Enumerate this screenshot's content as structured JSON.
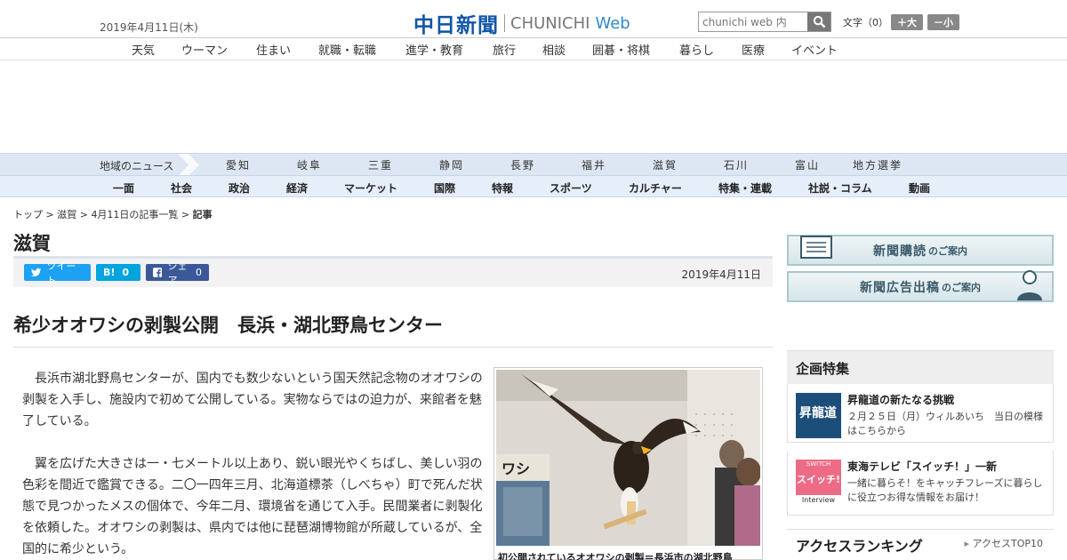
{
  "header": {
    "date": "2019年4月11日(木)",
    "logo_ja": "中日新聞",
    "logo_en": "CHUNICHI",
    "logo_web": "Web",
    "search_placeholder": "chunichi web 内",
    "font_label": "文字（0）",
    "font_bigger": "＋大",
    "font_smaller": "－小"
  },
  "nav_main": [
    "天気",
    "ウーマン",
    "住まい",
    "就職・転職",
    "進学・教育",
    "旅行",
    "相談",
    "囲碁・将棋",
    "暮らし",
    "医療",
    "イベント"
  ],
  "region_nav": {
    "label": "地域のニュース",
    "items": [
      "愛知",
      "岐阜",
      "三重",
      "静岡",
      "長野",
      "福井",
      "滋賀",
      "石川",
      "富山",
      "地方選挙"
    ]
  },
  "category_nav": [
    "一面",
    "社会",
    "政治",
    "経済",
    "マーケット",
    "国際",
    "特報",
    "スポーツ",
    "カルチャー",
    "特集・連載",
    "社説・コラム",
    "動画"
  ],
  "breadcrumb": {
    "top": "トップ",
    "sep": " > ",
    "pref": "滋賀",
    "list": "4月11日の記事一覧",
    "current": "記事"
  },
  "prefecture": "滋賀",
  "share": {
    "tweet": "ツイート",
    "hatena": "B!",
    "hatena_count": "0",
    "fb": "シェア",
    "fb_count": "0",
    "date": "2019年4月11日"
  },
  "article": {
    "headline": "希少オオワシの剥製公開　長浜・湖北野鳥センター",
    "paragraphs": [
      "長浜市湖北野鳥センターが、国内でも数少ないという国天然記念物のオオワシの剥製を入手し、施設内で初めて公開している。実物ならではの迫力が、来館者を魅了している。",
      "翼を広げた大きさは一・七メートル以上あり、鋭い眼光やくちばし、美しい羽の色彩を間近で鑑賞できる。二〇一四年三月、北海道標茶（しべちゃ）町で死んだ状態で見つかったメスの個体で、今年二月、環境省を通じて入手。民間業者に剥製化を依頼した。オオワシの剥製は、県内では他に琵琶湖博物館が所蔵しているが、全国的に希少という。"
    ],
    "photo_caption": "初公開されているオオワシの剥製＝長浜市の湖北野鳥",
    "photo_sign": "ワシ"
  },
  "sidebar": {
    "promo1": {
      "main": "新聞購読",
      "sub": "のご案内"
    },
    "promo2": {
      "main": "新聞広告出稿",
      "sub": "のご案内"
    },
    "features_title": "企画特集",
    "features": [
      {
        "title": "昇龍道の新たなる挑戦",
        "desc": "２月２５日（月）ウィルあいち　当日の模様はこちらから",
        "thumb_text": "昇龍道"
      },
      {
        "title": "東海テレビ「スイッチ！」一新",
        "desc": "一緒に暮らそ！をキャッチフレーズに暮らしに役立つお得な情報をお届け！",
        "thumb_top": "SWITCH",
        "thumb_main": "スイッチ!",
        "thumb_sub": "Interview"
      }
    ],
    "ranking_title": "アクセスランキング",
    "ranking_link": "アクセスTOP10"
  },
  "colors": {
    "brand": "#1155a8",
    "twitter": "#1da1f2",
    "hatena": "#00a4de",
    "facebook": "#3b5998"
  }
}
